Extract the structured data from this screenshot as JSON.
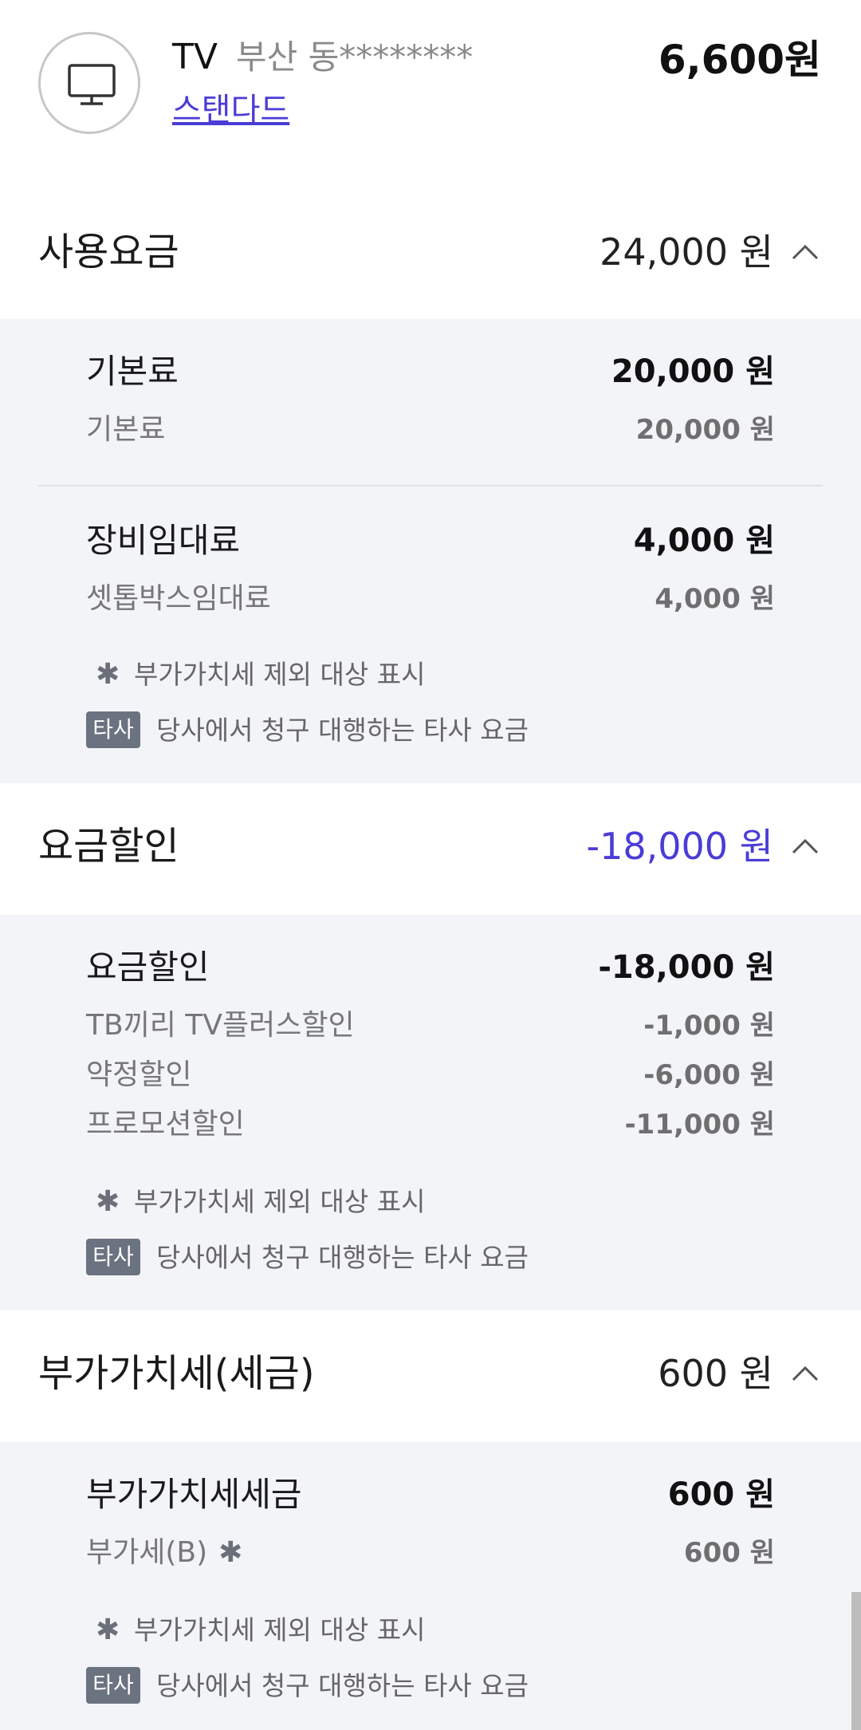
{
  "service": {
    "icon": "tv-icon",
    "name": "TV",
    "location": "부산 동********",
    "plan": "스탠다드",
    "total": "6,600원"
  },
  "sections": {
    "usage": {
      "title": "사용요금",
      "amount": "24,000 원",
      "groups": [
        {
          "label": "기본료",
          "amount": "20,000 원",
          "items": [
            {
              "label": "기본료",
              "amount": "20,000 원"
            }
          ]
        },
        {
          "label": "장비임대료",
          "amount": "4,000 원",
          "items": [
            {
              "label": "셋톱박스임대료",
              "amount": "4,000 원"
            }
          ]
        }
      ]
    },
    "discount": {
      "title": "요금할인",
      "amount": "-18,000 원",
      "groups": [
        {
          "label": "요금할인",
          "amount": "-18,000 원",
          "items": [
            {
              "label": "TB끼리 TV플러스할인",
              "amount": "-1,000 원"
            },
            {
              "label": "약정할인",
              "amount": "-6,000 원"
            },
            {
              "label": "프로모션할인",
              "amount": "-11,000 원"
            }
          ]
        }
      ]
    },
    "vat": {
      "title": "부가가치세(세금)",
      "amount": "600 원",
      "groups": [
        {
          "label": "부가가치세세금",
          "amount": "600 원",
          "items": [
            {
              "label": "부가세(B)",
              "marker": "✱",
              "amount": "600 원"
            }
          ]
        }
      ]
    }
  },
  "legend": {
    "star_symbol": "✱",
    "vat_exempt": "부가가치세 제외 대상 표시",
    "badge": "타사",
    "third_party": "당사에서 청구 대행하는 타사 요금"
  },
  "colors": {
    "accent": "#4a3cd6",
    "body_bg": "#f3f4f8",
    "badge_bg": "#6b7280"
  }
}
